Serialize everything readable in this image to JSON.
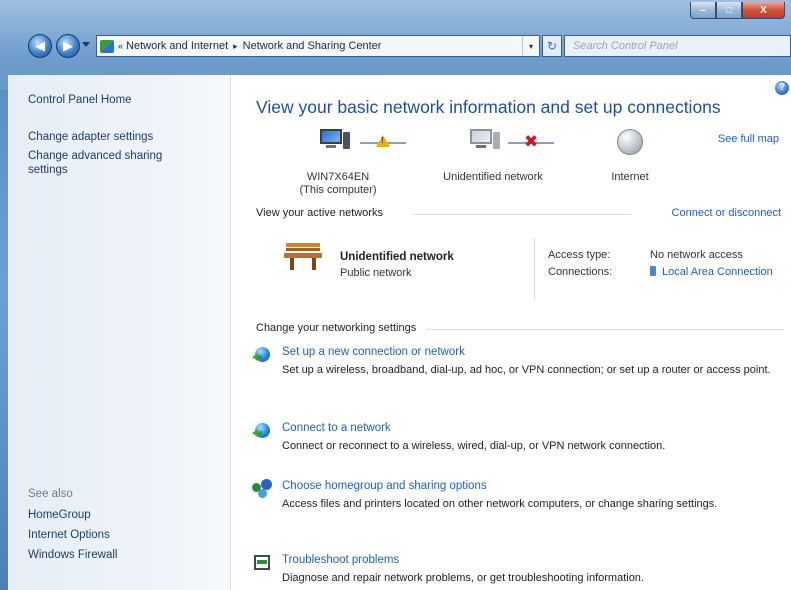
{
  "window": {
    "controls": {
      "minimize": "–",
      "maximize": "□",
      "close": "X"
    }
  },
  "address_bar": {
    "overflow": "«",
    "crumbs": [
      "Network and Internet",
      "Network and Sharing Center"
    ],
    "separator": "▸",
    "dropdown": "▾",
    "refresh": "↻",
    "search_placeholder": "Search Control Panel"
  },
  "nav": {
    "back": "◀",
    "forward": "▶"
  },
  "sidebar": {
    "home": "Control Panel Home",
    "links": [
      "Change adapter settings",
      "Change advanced sharing settings"
    ],
    "see_also_heading": "See also",
    "see_also": [
      "HomeGroup",
      "Internet Options",
      "Windows Firewall"
    ]
  },
  "main": {
    "help": "?",
    "title": "View your basic network information and set up connections",
    "see_full_map": "See full map",
    "map": {
      "computer_name": "WIN7X64EN",
      "computer_sub": "(This computer)",
      "network": "Unidentified network",
      "internet": "Internet",
      "warning_mark": "!",
      "error_mark": "✖"
    },
    "active_networks": {
      "heading": "View your active networks",
      "link": "Connect or disconnect",
      "network_name": "Unidentified network",
      "network_type": "Public network",
      "access_type_label": "Access type:",
      "access_type_value": "No network access",
      "connections_label": "Connections:",
      "connections_value": "Local Area Connection"
    },
    "settings": {
      "heading": "Change your networking settings",
      "tasks": [
        {
          "title": "Set up a new connection or network",
          "desc": "Set up a wireless, broadband, dial-up, ad hoc, or VPN connection; or set up a router or access point."
        },
        {
          "title": "Connect to a network",
          "desc": "Connect or reconnect to a wireless, wired, dial-up, or VPN network connection."
        },
        {
          "title": "Choose homegroup and sharing options",
          "desc": "Access files and printers located on other network computers, or change sharing settings."
        },
        {
          "title": "Troubleshoot problems",
          "desc": "Diagnose and repair network problems, or get troubleshooting information."
        }
      ]
    }
  },
  "colors": {
    "link": "#1f5fbf",
    "title": "#1f4f9c",
    "warning": "#e8b10f",
    "error": "#d0171f"
  },
  "icons": {
    "computer": "computer-icon",
    "network": "network-computer-icon",
    "internet": "globe-icon",
    "bench": "public-network-bench-icon",
    "connection": "network-adapter-icon"
  }
}
